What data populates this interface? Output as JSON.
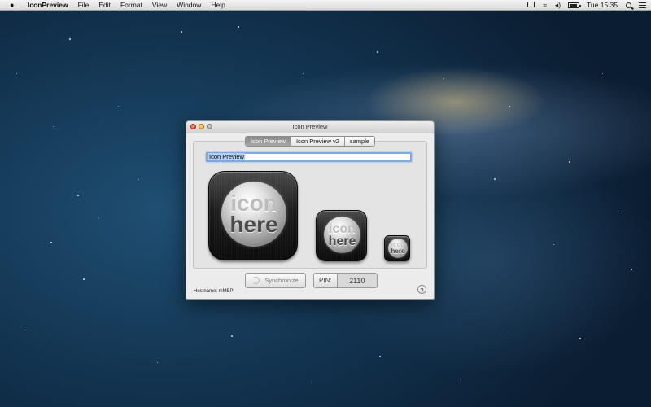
{
  "menubar": {
    "app_name": "IconPreview",
    "items": [
      "File",
      "Edit",
      "Format",
      "View",
      "Window",
      "Help"
    ],
    "clock": "Tue 15:35",
    "tray_icons": [
      "display-icon",
      "wifi-icon",
      "volume-icon",
      "battery-icon",
      "search-icon",
      "list-icon"
    ]
  },
  "window": {
    "title": "Icon Preview",
    "tabs": [
      {
        "label": "Icon Preview",
        "active": true
      },
      {
        "label": "Icon Preview v2",
        "active": false
      },
      {
        "label": "sample",
        "active": false
      }
    ],
    "name_field": "Icon Preview",
    "icons": [
      {
        "size": "large",
        "word1": "icon",
        "word2": "here"
      },
      {
        "size": "medium",
        "word1": "icon",
        "word2": "here"
      },
      {
        "size": "small",
        "word1": "icon",
        "word2": "here"
      }
    ],
    "sync_button": "Synchronize",
    "pin_label": "PIN:",
    "pin_value": "2110",
    "hostname": "Hostname: mMBP",
    "help_label": "?"
  }
}
